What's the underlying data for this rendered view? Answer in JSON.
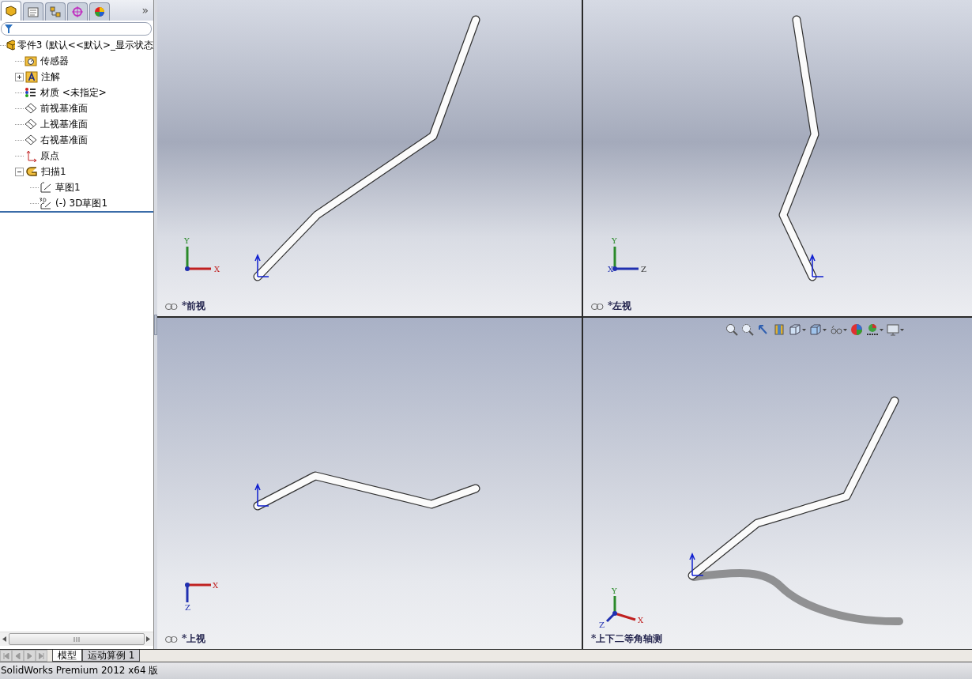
{
  "panel_tabs": [
    {
      "kind": "feature-tree",
      "selected": true
    },
    {
      "kind": "properties",
      "selected": false
    },
    {
      "kind": "configurations",
      "selected": false
    },
    {
      "kind": "dimxpert",
      "selected": false
    },
    {
      "kind": "display",
      "selected": false
    }
  ],
  "panel_more": "»",
  "tree": [
    {
      "kind": "part",
      "label": "零件3  (默认<<默认>_显示状态",
      "children": [
        {
          "kind": "sensor",
          "label": "传感器"
        },
        {
          "kind": "annotation",
          "label": "注解",
          "expanded": false
        },
        {
          "kind": "material",
          "label": "材质 <未指定>"
        },
        {
          "kind": "plane",
          "label": "前视基准面"
        },
        {
          "kind": "plane",
          "label": "上视基准面"
        },
        {
          "kind": "plane",
          "label": "右视基准面"
        },
        {
          "kind": "origin",
          "label": "原点"
        },
        {
          "kind": "sweep",
          "label": "扫描1",
          "expanded": true,
          "children": [
            {
              "kind": "sketch",
              "label": "草图1"
            },
            {
              "kind": "sketch3d",
              "label": "(-) 3D草图1"
            }
          ]
        }
      ]
    }
  ],
  "viewports": [
    {
      "kind": "front",
      "label": "*前视",
      "linked": true,
      "axes": [
        "Y",
        "X"
      ]
    },
    {
      "kind": "left",
      "label": "*左视",
      "linked": true,
      "axes": [
        "Y",
        "X",
        "Z"
      ]
    },
    {
      "kind": "top",
      "label": "*上视",
      "linked": true,
      "axes": [
        "X",
        "Z"
      ]
    },
    {
      "kind": "iso",
      "label": "*上下二等角轴测",
      "linked": false,
      "axes": [
        "Y",
        "Z",
        "X"
      ],
      "toolbar": [
        {
          "kind": "zoom-fit",
          "dropdown": false
        },
        {
          "kind": "zoom-area",
          "dropdown": false
        },
        {
          "kind": "previous-view",
          "dropdown": false
        },
        {
          "kind": "section-view",
          "dropdown": false
        },
        {
          "kind": "view-orientation",
          "dropdown": true
        },
        {
          "kind": "display-style",
          "dropdown": true
        },
        {
          "kind": "hide-show",
          "dropdown": true
        },
        {
          "kind": "appearance",
          "dropdown": false
        },
        {
          "kind": "scene",
          "dropdown": true
        },
        {
          "kind": "view-settings",
          "dropdown": true
        }
      ]
    }
  ],
  "bottom_tabs": [
    {
      "label": "模型",
      "selected": true
    },
    {
      "label": "运动算例 1",
      "selected": false
    }
  ],
  "status_bar": "SolidWorks Premium 2012 x64 版"
}
